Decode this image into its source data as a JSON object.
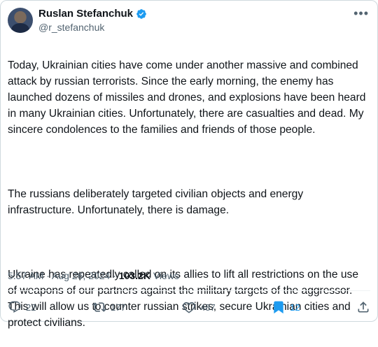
{
  "author": {
    "name": "Ruslan Stefanchuk",
    "handle": "@r_stefanchuk",
    "verified_color": "#1d9bf0"
  },
  "more_icon": "more-icon",
  "body": {
    "p1": "Today, Ukrainian cities have come under another massive and combined attack by russian terrorists. Since the early morning, the enemy has launched dozens of missiles and drones, and explosions have been heard in many Ukrainian cities. Unfortunately, there are casualties and dead. My sincere condolences to the families and friends of those people.",
    "p2": "The russians deliberately targeted civilian objects and energy infrastructure. Unfortunately, there is damage.",
    "p3": "Ukraine has repeatedly called on its allies to lift all restrictions on the use of weapons of our  partners against the military targets of the aggressor. This will allow us to counter russian strikes, secure Ukrainian cities and protect civilians."
  },
  "meta": {
    "time": "5:57 AM",
    "separator": " · ",
    "date": "Aug 26, 2024",
    "views_count": "103.2K",
    "views_label": " Views"
  },
  "actions": {
    "replies": "22",
    "reposts": "177",
    "likes": "487",
    "bookmarks": "12"
  },
  "colors": {
    "text": "#0f1419",
    "secondary": "#536471",
    "accent": "#1d9bf0"
  }
}
